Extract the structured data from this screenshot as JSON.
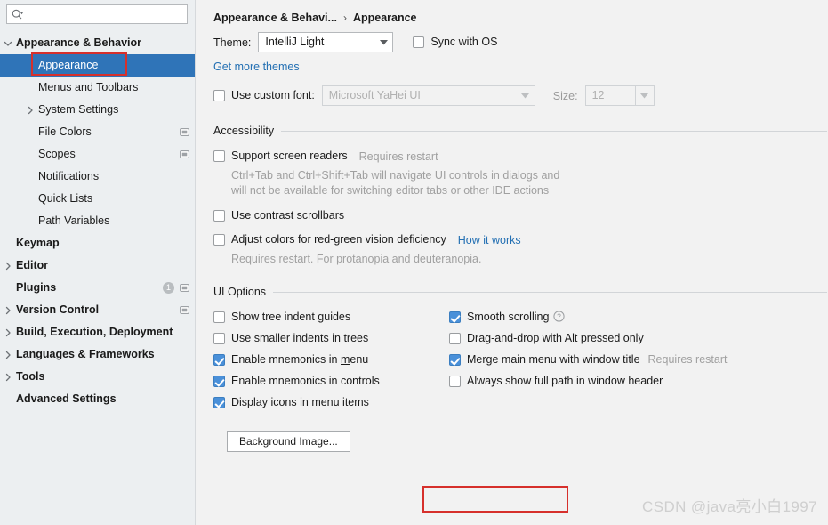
{
  "search": {
    "placeholder": "",
    "value": "",
    "icon": "search-icon"
  },
  "sidebar": {
    "items": [
      {
        "label": "Appearance & Behavior",
        "level": 0,
        "twisty": "chevron-down",
        "selected": false,
        "bold": true
      },
      {
        "label": "Appearance",
        "level": 1,
        "twisty": "none",
        "selected": true,
        "bold": false
      },
      {
        "label": "Menus and Toolbars",
        "level": 1,
        "twisty": "none",
        "selected": false,
        "bold": false
      },
      {
        "label": "System Settings",
        "level": 1,
        "twisty": "chevron-right",
        "selected": false,
        "bold": false
      },
      {
        "label": "File Colors",
        "level": 1,
        "twisty": "none",
        "selected": false,
        "bold": false,
        "scope_icon": true
      },
      {
        "label": "Scopes",
        "level": 1,
        "twisty": "none",
        "selected": false,
        "bold": false,
        "scope_icon": true
      },
      {
        "label": "Notifications",
        "level": 1,
        "twisty": "none",
        "selected": false,
        "bold": false
      },
      {
        "label": "Quick Lists",
        "level": 1,
        "twisty": "none",
        "selected": false,
        "bold": false
      },
      {
        "label": "Path Variables",
        "level": 1,
        "twisty": "none",
        "selected": false,
        "bold": false
      },
      {
        "label": "Keymap",
        "level": 0,
        "twisty": "none",
        "selected": false,
        "bold": true
      },
      {
        "label": "Editor",
        "level": 0,
        "twisty": "chevron-right",
        "selected": false,
        "bold": true
      },
      {
        "label": "Plugins",
        "level": 0,
        "twisty": "none",
        "selected": false,
        "bold": true,
        "badge": "1",
        "scope_icon": true
      },
      {
        "label": "Version Control",
        "level": 0,
        "twisty": "chevron-right",
        "selected": false,
        "bold": true,
        "scope_icon": true
      },
      {
        "label": "Build, Execution, Deployment",
        "level": 0,
        "twisty": "chevron-right",
        "selected": false,
        "bold": true
      },
      {
        "label": "Languages & Frameworks",
        "level": 0,
        "twisty": "chevron-right",
        "selected": false,
        "bold": true
      },
      {
        "label": "Tools",
        "level": 0,
        "twisty": "chevron-right",
        "selected": false,
        "bold": true
      },
      {
        "label": "Advanced Settings",
        "level": 0,
        "twisty": "none",
        "selected": false,
        "bold": true
      }
    ]
  },
  "breadcrumb": {
    "parent": "Appearance & Behavi...",
    "separator": "›",
    "current": "Appearance"
  },
  "theme": {
    "label": "Theme:",
    "value": "IntelliJ Light",
    "sync_label": "Sync with OS",
    "sync_checked": false,
    "more_themes_link": "Get more themes"
  },
  "font": {
    "use_custom_label": "Use custom font:",
    "use_custom_checked": false,
    "family_value": "Microsoft YaHei UI",
    "size_label": "Size:",
    "size_value": "12",
    "disabled": true
  },
  "accessibility": {
    "title": "Accessibility",
    "screen_readers": {
      "label": "Support screen readers",
      "hint": "Requires restart",
      "checked": false,
      "desc_line1": "Ctrl+Tab and Ctrl+Shift+Tab will navigate UI controls in dialogs and",
      "desc_line2": "will not be available for switching editor tabs or other IDE actions"
    },
    "contrast_scrollbars": {
      "label": "Use contrast scrollbars",
      "checked": false
    },
    "red_green": {
      "label": "Adjust colors for red-green vision deficiency",
      "link": "How it works",
      "checked": false,
      "desc": "Requires restart. For protanopia and deuteranopia."
    }
  },
  "ui_options": {
    "title": "UI Options",
    "left": [
      {
        "label_pre": "Show tree indent guides",
        "label_mnemonic": "",
        "label_post": "",
        "checked": false
      },
      {
        "label_pre": "Use smaller indents in trees",
        "label_mnemonic": "",
        "label_post": "",
        "checked": false
      },
      {
        "label_pre": "Enable mnemonics in ",
        "label_mnemonic": "m",
        "label_post": "enu",
        "checked": true
      },
      {
        "label_pre": "Enable mnemonics in controls",
        "label_mnemonic": "",
        "label_post": "",
        "checked": true
      },
      {
        "label_pre": "Display icons in menu items",
        "label_mnemonic": "",
        "label_post": "",
        "checked": true
      }
    ],
    "right": [
      {
        "label": "Smooth scrolling",
        "checked": true,
        "help_icon": true,
        "hint": ""
      },
      {
        "label": "Drag-and-drop with Alt pressed only",
        "checked": false,
        "help_icon": false,
        "hint": ""
      },
      {
        "label": "Merge main menu with window title",
        "checked": true,
        "help_icon": false,
        "hint": "Requires restart"
      },
      {
        "label": "Always show full path in window header",
        "checked": false,
        "help_icon": false,
        "hint": ""
      }
    ],
    "background_image_button": "Background Image..."
  },
  "watermark": "CSDN @java亮小白1997",
  "colors": {
    "selection_blue": "#2f74b8",
    "checkbox_blue": "#4a90d9",
    "link_blue": "#2470b3",
    "annotation_red": "#d6302c",
    "sidebar_bg": "#eceff1",
    "content_bg": "#f2f2f2",
    "hint_grey": "#a0a0a0"
  }
}
